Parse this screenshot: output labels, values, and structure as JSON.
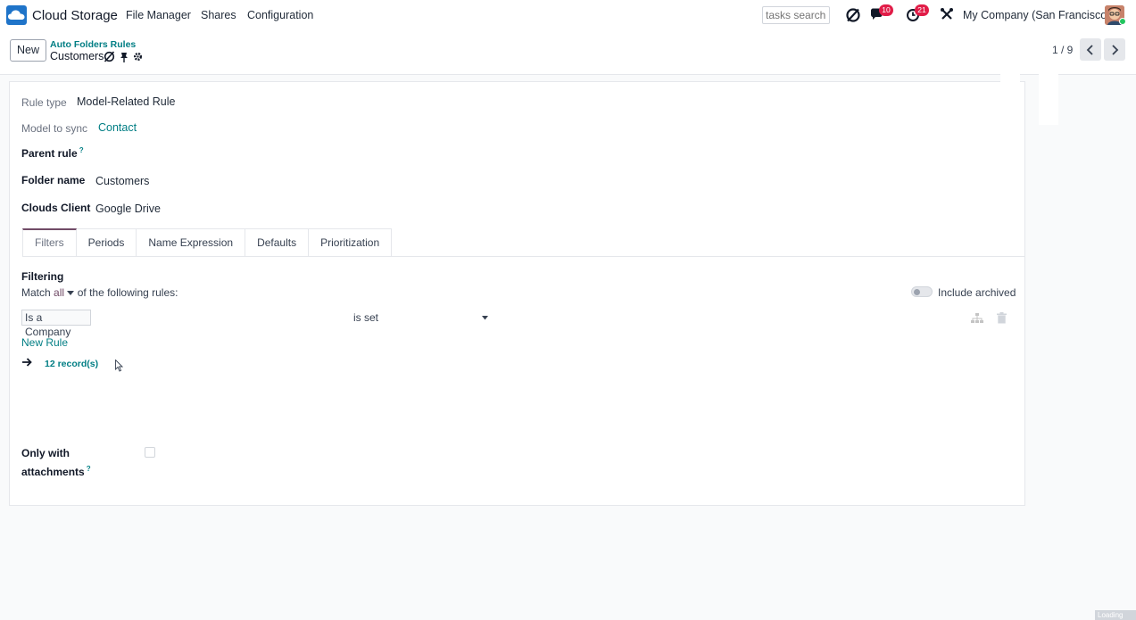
{
  "navbar": {
    "app_name": "Cloud Storage",
    "menu": [
      "File Manager",
      "Shares",
      "Configuration"
    ],
    "search_placeholder": "tasks search",
    "messages_count": "10",
    "activities_count": "21",
    "company": "My Company (San Francisco)",
    "icons": [
      "cloud-logo-icon",
      "discuss-icon",
      "chat-icon",
      "activity-clock-icon",
      "debug-tools-icon",
      "user-avatar"
    ]
  },
  "control": {
    "new_label": "New",
    "breadcrumb_parent": "Auto Folders Rules",
    "breadcrumb_current": "Customers",
    "pager": "1 / 9",
    "icons": [
      "sync-icon",
      "pin-icon",
      "gear-icon",
      "chevron-left-icon",
      "chevron-right-icon"
    ]
  },
  "form": {
    "rule_type_label": "Rule type",
    "rule_type_value": "Model-Related Rule",
    "model_label": "Model to sync",
    "model_value": "Contact",
    "parent_rule_label": "Parent rule",
    "help_mark": "?",
    "folder_name_label": "Folder name",
    "folder_name_value": "Customers",
    "clouds_client_label": "Clouds Client",
    "clouds_client_value": "Google Drive",
    "tabs": [
      "Filters",
      "Periods",
      "Name Expression",
      "Defaults",
      "Prioritization"
    ],
    "filtering_title": "Filtering",
    "match_prefix": "Match",
    "match_value": "all",
    "match_suffix": "of the following rules:",
    "include_archived": "Include archived",
    "filter_field": "Is a Company",
    "filter_operator": "is set",
    "new_rule": "New Rule",
    "records": "12 record(s)",
    "only_with_line1": "Only with",
    "only_with_line2": "attachments"
  },
  "colors": {
    "accent_teal": "#017e84",
    "tab_active": "#714b67",
    "badge_red": "#e11d48",
    "logo_blue": "#1f74c9"
  },
  "status": {
    "loading": "Loading"
  }
}
